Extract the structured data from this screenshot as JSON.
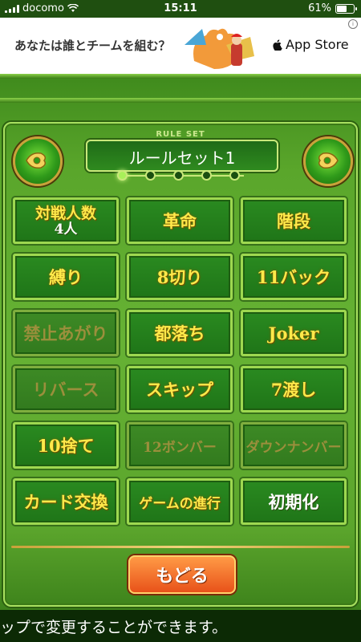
{
  "status": {
    "carrier": "docomo",
    "time": "15:11",
    "battery": "61%",
    "battery_level": 0.61
  },
  "ad": {
    "text": "あなたは誰とチームを組む？",
    "store": "App Store"
  },
  "ruleset": {
    "caption": "RULE SET",
    "name": "ルールセット1",
    "pages": 5,
    "active_page": 1
  },
  "rules": [
    {
      "label": "対戦人数",
      "value": "4人",
      "enabled": true
    },
    {
      "label": "革命",
      "enabled": true
    },
    {
      "label": "階段",
      "enabled": true
    },
    {
      "label": "縛り",
      "enabled": true
    },
    {
      "label": "8切り",
      "enabled": true
    },
    {
      "label": "11バック",
      "enabled": true
    },
    {
      "label": "禁止あがり",
      "enabled": false
    },
    {
      "label": "都落ち",
      "enabled": true
    },
    {
      "label": "Joker",
      "enabled": true
    },
    {
      "label": "リバース",
      "enabled": false
    },
    {
      "label": "スキップ",
      "enabled": true
    },
    {
      "label": "7渡し",
      "enabled": true
    },
    {
      "label": "10捨て",
      "enabled": true
    },
    {
      "label": "12ボンバー",
      "enabled": false
    },
    {
      "label": "ダウンナンバー",
      "enabled": false
    },
    {
      "label": "カード交換",
      "enabled": true
    },
    {
      "label": "ゲームの進行",
      "enabled": true
    },
    {
      "label": "初期化",
      "enabled": true,
      "style": "white"
    }
  ],
  "back_button": "もどる",
  "footer": {
    "message": "ップで変更することができます。"
  }
}
